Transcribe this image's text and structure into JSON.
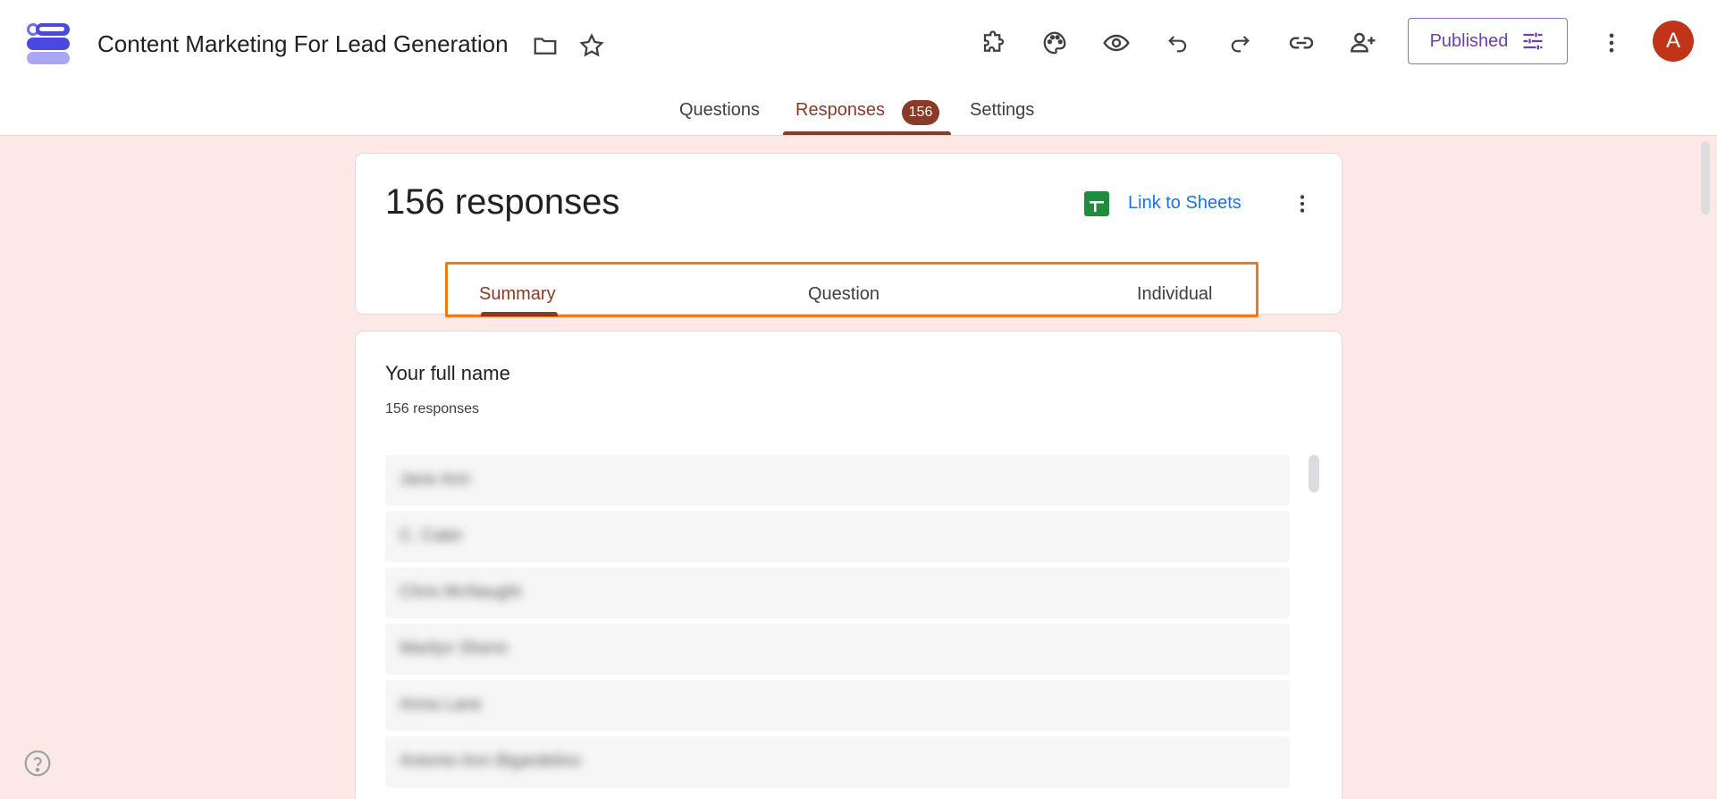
{
  "header": {
    "doc_title": "Content Marketing For Lead Generation",
    "publish_label": "Published",
    "avatar_initial": "A",
    "icons": [
      "folder-icon",
      "star-icon",
      "addons-icon",
      "palette-icon",
      "preview-icon",
      "undo-icon",
      "redo-icon",
      "link-icon",
      "add-collaborator-icon",
      "more-vert-icon"
    ]
  },
  "tabs": {
    "questions": "Questions",
    "responses": "Responses",
    "responses_badge": "156",
    "settings": "Settings"
  },
  "summary_card": {
    "count_label": "156 responses",
    "sheets_link": "Link to Sheets",
    "sub_tabs": {
      "summary": "Summary",
      "question": "Question",
      "individual": "Individual"
    }
  },
  "question_card": {
    "title": "Your full name",
    "count_label": "156 responses",
    "responses": [
      "Jane Ann",
      "C. Cater",
      "Chris McNaught",
      "Marilyn Shenn",
      "Anna Lane",
      "Antonio Ann Bigardelino"
    ]
  },
  "colors": {
    "accent": "#8a3a26",
    "background": "#fce8e4",
    "highlight": "#f07a1a",
    "link": "#1a73e8",
    "publish": "#6b3fb5"
  }
}
